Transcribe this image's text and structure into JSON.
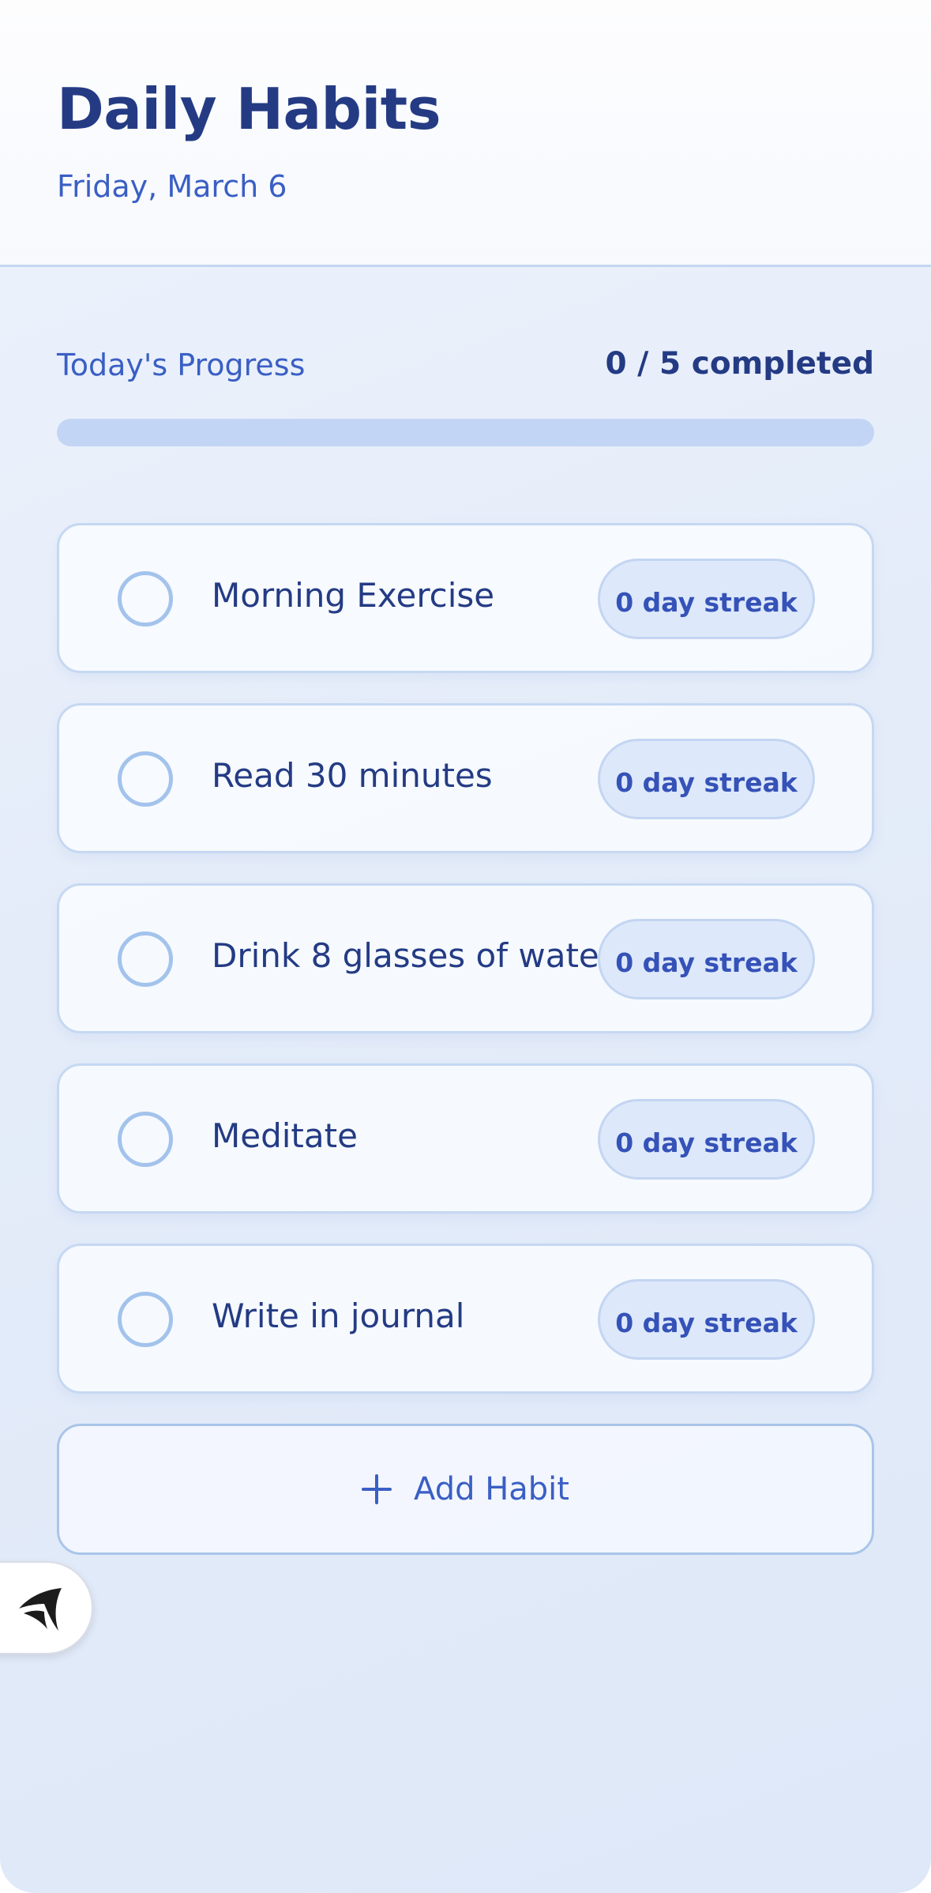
{
  "header": {
    "title": "Daily Habits",
    "date": "Friday, March 6"
  },
  "progress": {
    "label": "Today's Progress",
    "completed_text": "0 / 5 completed",
    "completed": 0,
    "total": 5,
    "fraction": 0
  },
  "habits": [
    {
      "name": "Morning Exercise",
      "streak": "0 day streak",
      "done": false
    },
    {
      "name": "Read 30 minutes",
      "streak": "0 day streak",
      "done": false
    },
    {
      "name": "Drink 8 glasses of water",
      "streak": "0 day streak",
      "done": false
    },
    {
      "name": "Meditate",
      "streak": "0 day streak",
      "done": false
    },
    {
      "name": "Write in journal",
      "streak": "0 day streak",
      "done": false
    }
  ],
  "add_button": {
    "label": "Add Habit",
    "icon": "plus-icon"
  },
  "floating_badge": {
    "icon": "app-logo-icon"
  },
  "colors": {
    "title": "#243b84",
    "accent": "#3a5fc4",
    "progress_track": "#c3d5f4",
    "check_ring": "#a3c3ec",
    "streak_badge_bg": "#dde8fa"
  }
}
